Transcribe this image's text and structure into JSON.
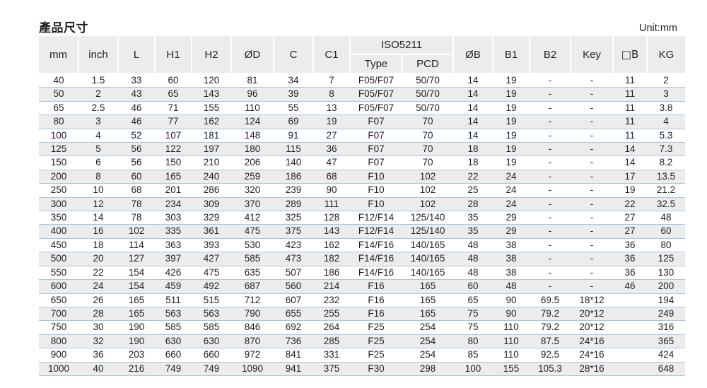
{
  "header": {
    "title": "產品尺寸",
    "unit_label": "Unit:mm"
  },
  "table": {
    "group_headers": {
      "iso5211": "ISO5211"
    },
    "columns": [
      "mm",
      "inch",
      "L",
      "H1",
      "H2",
      "ØD",
      "C",
      "C1",
      "Type",
      "PCD",
      "ØB",
      "B1",
      "B2",
      "Key",
      "□B",
      "KG"
    ],
    "rows": [
      {
        "mm": "40",
        "inch": "1.5",
        "L": "33",
        "H1": "60",
        "H2": "120",
        "OD": "81",
        "C": "34",
        "C1": "7",
        "type": "F05/F07",
        "pcd": "50/70",
        "OB": "14",
        "B1": "19",
        "B2": "-",
        "key": "-",
        "sqB": "11",
        "kg": "2"
      },
      {
        "mm": "50",
        "inch": "2",
        "L": "43",
        "H1": "65",
        "H2": "143",
        "OD": "96",
        "C": "39",
        "C1": "8",
        "type": "F05/F07",
        "pcd": "50/70",
        "OB": "14",
        "B1": "19",
        "B2": "-",
        "key": "-",
        "sqB": "11",
        "kg": "3"
      },
      {
        "mm": "65",
        "inch": "2.5",
        "L": "46",
        "H1": "71",
        "H2": "155",
        "OD": "110",
        "C": "55",
        "C1": "13",
        "type": "F05/F07",
        "pcd": "50/70",
        "OB": "14",
        "B1": "19",
        "B2": "-",
        "key": "-",
        "sqB": "11",
        "kg": "3.8"
      },
      {
        "mm": "80",
        "inch": "3",
        "L": "46",
        "H1": "77",
        "H2": "162",
        "OD": "124",
        "C": "69",
        "C1": "19",
        "type": "F07",
        "pcd": "70",
        "OB": "14",
        "B1": "19",
        "B2": "-",
        "key": "-",
        "sqB": "11",
        "kg": "4"
      },
      {
        "mm": "100",
        "inch": "4",
        "L": "52",
        "H1": "107",
        "H2": "181",
        "OD": "148",
        "C": "91",
        "C1": "27",
        "type": "F07",
        "pcd": "70",
        "OB": "14",
        "B1": "19",
        "B2": "-",
        "key": "-",
        "sqB": "11",
        "kg": "5.3"
      },
      {
        "mm": "125",
        "inch": "5",
        "L": "56",
        "H1": "122",
        "H2": "197",
        "OD": "180",
        "C": "115",
        "C1": "36",
        "type": "F07",
        "pcd": "70",
        "OB": "18",
        "B1": "19",
        "B2": "-",
        "key": "-",
        "sqB": "14",
        "kg": "7.3"
      },
      {
        "mm": "150",
        "inch": "6",
        "L": "56",
        "H1": "150",
        "H2": "210",
        "OD": "206",
        "C": "140",
        "C1": "47",
        "type": "F07",
        "pcd": "70",
        "OB": "18",
        "B1": "19",
        "B2": "-",
        "key": "-",
        "sqB": "14",
        "kg": "8.2"
      },
      {
        "mm": "200",
        "inch": "8",
        "L": "60",
        "H1": "165",
        "H2": "240",
        "OD": "259",
        "C": "186",
        "C1": "68",
        "type": "F10",
        "pcd": "102",
        "OB": "22",
        "B1": "24",
        "B2": "-",
        "key": "-",
        "sqB": "17",
        "kg": "13.5"
      },
      {
        "mm": "250",
        "inch": "10",
        "L": "68",
        "H1": "201",
        "H2": "286",
        "OD": "320",
        "C": "239",
        "C1": "90",
        "type": "F10",
        "pcd": "102",
        "OB": "25",
        "B1": "24",
        "B2": "-",
        "key": "-",
        "sqB": "19",
        "kg": "21.2"
      },
      {
        "mm": "300",
        "inch": "12",
        "L": "78",
        "H1": "234",
        "H2": "309",
        "OD": "370",
        "C": "289",
        "C1": "111",
        "type": "F10",
        "pcd": "102",
        "OB": "28",
        "B1": "24",
        "B2": "-",
        "key": "-",
        "sqB": "22",
        "kg": "32.5"
      },
      {
        "mm": "350",
        "inch": "14",
        "L": "78",
        "H1": "303",
        "H2": "329",
        "OD": "412",
        "C": "325",
        "C1": "128",
        "type": "F12/F14",
        "pcd": "125/140",
        "OB": "35",
        "B1": "29",
        "B2": "-",
        "key": "-",
        "sqB": "27",
        "kg": "48"
      },
      {
        "mm": "400",
        "inch": "16",
        "L": "102",
        "H1": "335",
        "H2": "361",
        "OD": "475",
        "C": "375",
        "C1": "143",
        "type": "F12/F14",
        "pcd": "125/140",
        "OB": "35",
        "B1": "29",
        "B2": "-",
        "key": "-",
        "sqB": "27",
        "kg": "60"
      },
      {
        "mm": "450",
        "inch": "18",
        "L": "114",
        "H1": "363",
        "H2": "393",
        "OD": "530",
        "C": "423",
        "C1": "162",
        "type": "F14/F16",
        "pcd": "140/165",
        "OB": "48",
        "B1": "38",
        "B2": "-",
        "key": "-",
        "sqB": "36",
        "kg": "80"
      },
      {
        "mm": "500",
        "inch": "20",
        "L": "127",
        "H1": "397",
        "H2": "427",
        "OD": "585",
        "C": "473",
        "C1": "182",
        "type": "F14/F16",
        "pcd": "140/165",
        "OB": "48",
        "B1": "38",
        "B2": "-",
        "key": "-",
        "sqB": "36",
        "kg": "125"
      },
      {
        "mm": "550",
        "inch": "22",
        "L": "154",
        "H1": "426",
        "H2": "475",
        "OD": "635",
        "C": "507",
        "C1": "186",
        "type": "F14/F16",
        "pcd": "140/165",
        "OB": "48",
        "B1": "38",
        "B2": "-",
        "key": "-",
        "sqB": "36",
        "kg": "130"
      },
      {
        "mm": "600",
        "inch": "24",
        "L": "154",
        "H1": "459",
        "H2": "492",
        "OD": "687",
        "C": "560",
        "C1": "214",
        "type": "F16",
        "pcd": "165",
        "OB": "60",
        "B1": "48",
        "B2": "-",
        "key": "-",
        "sqB": "46",
        "kg": "200"
      },
      {
        "mm": "650",
        "inch": "26",
        "L": "165",
        "H1": "511",
        "H2": "515",
        "OD": "712",
        "C": "607",
        "C1": "232",
        "type": "F16",
        "pcd": "165",
        "OB": "65",
        "B1": "90",
        "B2": "69.5",
        "key": "18*12",
        "sqB": "",
        "kg": "194"
      },
      {
        "mm": "700",
        "inch": "28",
        "L": "165",
        "H1": "563",
        "H2": "563",
        "OD": "790",
        "C": "655",
        "C1": "255",
        "type": "F16",
        "pcd": "165",
        "OB": "75",
        "B1": "90",
        "B2": "79.2",
        "key": "20*12",
        "sqB": "",
        "kg": "249"
      },
      {
        "mm": "750",
        "inch": "30",
        "L": "190",
        "H1": "585",
        "H2": "585",
        "OD": "846",
        "C": "692",
        "C1": "264",
        "type": "F25",
        "pcd": "254",
        "OB": "75",
        "B1": "110",
        "B2": "79.2",
        "key": "20*12",
        "sqB": "",
        "kg": "316"
      },
      {
        "mm": "800",
        "inch": "32",
        "L": "190",
        "H1": "630",
        "H2": "630",
        "OD": "870",
        "C": "736",
        "C1": "285",
        "type": "F25",
        "pcd": "254",
        "OB": "80",
        "B1": "110",
        "B2": "87.5",
        "key": "24*16",
        "sqB": "",
        "kg": "365"
      },
      {
        "mm": "900",
        "inch": "36",
        "L": "203",
        "H1": "660",
        "H2": "660",
        "OD": "972",
        "C": "841",
        "C1": "331",
        "type": "F25",
        "pcd": "254",
        "OB": "85",
        "B1": "110",
        "B2": "92.5",
        "key": "24*16",
        "sqB": "",
        "kg": "424"
      },
      {
        "mm": "1000",
        "inch": "40",
        "L": "216",
        "H1": "749",
        "H2": "749",
        "OD": "1090",
        "C": "941",
        "C1": "375",
        "type": "F30",
        "pcd": "298",
        "OB": "100",
        "B1": "155",
        "B2": "105.3",
        "key": "28*16",
        "sqB": "",
        "kg": "648"
      }
    ]
  },
  "colors": {
    "header_bg": "#ececec",
    "row_alt_bg": "#ececec",
    "rule": "#a8c6e2",
    "text": "#231f20"
  }
}
